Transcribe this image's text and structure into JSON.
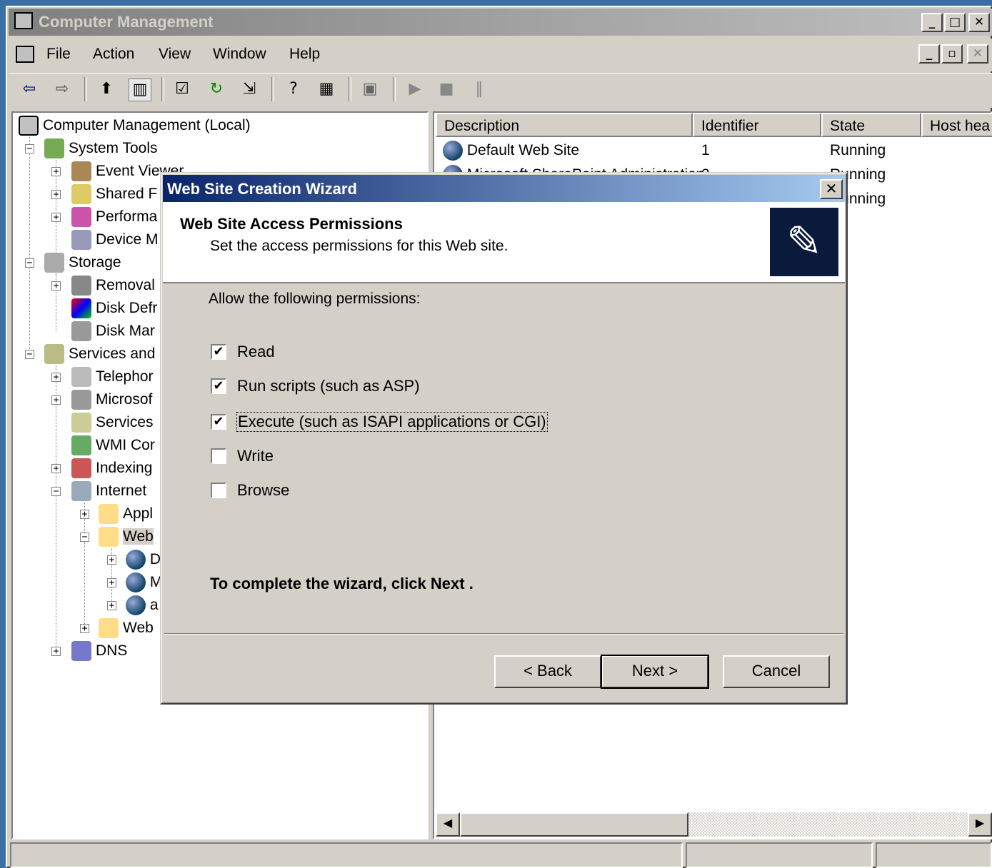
{
  "window": {
    "title": "Computer Management",
    "minimize_icon": "minimize-icon",
    "maximize_icon": "maximize-icon",
    "close_icon": "close-icon"
  },
  "menu": {
    "items": [
      "File",
      "Action",
      "View",
      "Window",
      "Help"
    ]
  },
  "toolbar": {
    "icons": [
      "back-arrow-icon",
      "forward-arrow-icon",
      "up-folder-icon",
      "show-hide-tree-icon",
      "properties-icon",
      "refresh-icon",
      "export-list-icon",
      "help-icon",
      "console-tree-icon",
      "computer-icon",
      "play-icon",
      "stop-icon",
      "pause-icon"
    ]
  },
  "tree": {
    "root": "Computer Management (Local)",
    "nodes": [
      {
        "label": "System Tools"
      },
      {
        "label": "Event Viewer"
      },
      {
        "label": "Shared F"
      },
      {
        "label": "Performa"
      },
      {
        "label": "Device M"
      },
      {
        "label": "Storage"
      },
      {
        "label": "Removal"
      },
      {
        "label": "Disk Defr"
      },
      {
        "label": "Disk Mar"
      },
      {
        "label": "Services and"
      },
      {
        "label": "Telephor"
      },
      {
        "label": "Microsof"
      },
      {
        "label": "Services"
      },
      {
        "label": "WMI Cor"
      },
      {
        "label": "Indexing"
      },
      {
        "label": "Internet"
      },
      {
        "label": "Appl"
      },
      {
        "label": "Web"
      },
      {
        "label": "D"
      },
      {
        "label": "M"
      },
      {
        "label": "a"
      },
      {
        "label": "Web"
      },
      {
        "label": "DNS"
      }
    ]
  },
  "list": {
    "columns": [
      "Description",
      "Identifier",
      "State",
      "Host hea"
    ],
    "rows": [
      {
        "description": "Default Web Site",
        "identifier": "1",
        "state": "Running"
      },
      {
        "description": "Microsoft SharePoint Administration",
        "identifier": "2",
        "state": "Running"
      },
      {
        "description": "",
        "identifier": "",
        "state": "Running"
      }
    ]
  },
  "wizard": {
    "title": "Web Site Creation Wizard",
    "heading": "Web Site Access Permissions",
    "subheading": "Set the access permissions for this Web site.",
    "prompt": "Allow the following permissions:",
    "permissions": [
      {
        "label": "Read",
        "checked": true
      },
      {
        "label": "Run scripts (such as ASP)",
        "checked": true
      },
      {
        "label": "Execute (such as ISAPI applications or CGI)",
        "checked": true
      },
      {
        "label": "Write",
        "checked": false
      },
      {
        "label": "Browse",
        "checked": false
      }
    ],
    "footer_text": "To complete the wizard, click Next .",
    "buttons": {
      "back": "< Back",
      "next": "Next >",
      "cancel": "Cancel"
    },
    "check_mark": "✔"
  },
  "colors": {
    "desktop": "#3a6ea5",
    "active_title_start": "#0a246a",
    "active_title_end": "#a6caf0",
    "face": "#d4d0c8"
  }
}
